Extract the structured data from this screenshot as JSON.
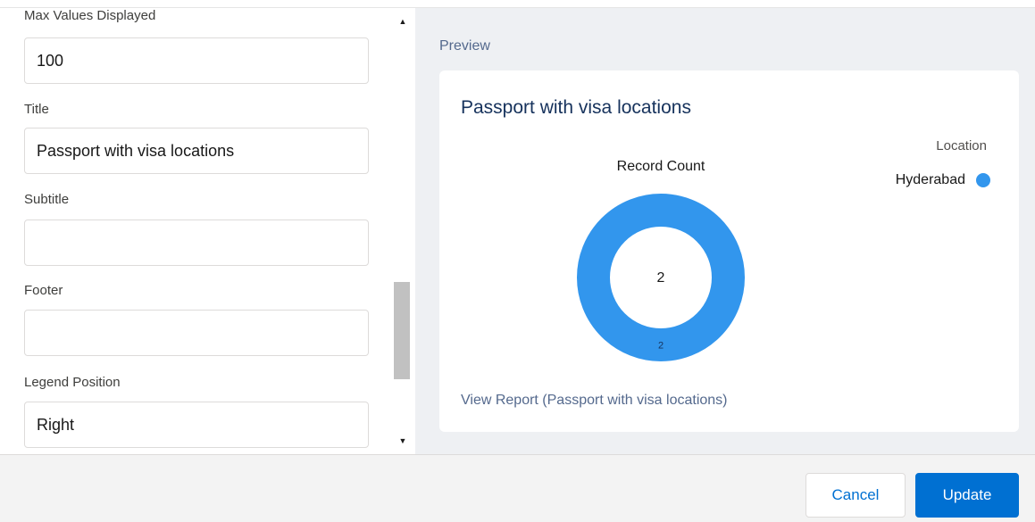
{
  "form": {
    "fields": [
      {
        "label": "Max Values Displayed",
        "value": "100"
      },
      {
        "label": "Title",
        "value": "Passport with visa locations"
      },
      {
        "label": "Subtitle",
        "value": ""
      },
      {
        "label": "Footer",
        "value": ""
      },
      {
        "label": "Legend Position",
        "value": "Right"
      }
    ]
  },
  "preview": {
    "heading": "Preview",
    "view_report_link": "View Report (Passport with visa locations)"
  },
  "chart_data": {
    "type": "donut",
    "title": "Passport with visa locations",
    "measure_label": "Record Count",
    "center_value": "2",
    "categories": [
      "Hyderabad"
    ],
    "values": [
      2
    ],
    "slice_labels": [
      "2"
    ],
    "colors": [
      "#3296ed"
    ],
    "legend": {
      "title": "Location",
      "position": "right"
    }
  },
  "footer": {
    "cancel_label": "Cancel",
    "update_label": "Update"
  },
  "colors": {
    "brand": "#0070d2",
    "slice": "#3296ed"
  }
}
